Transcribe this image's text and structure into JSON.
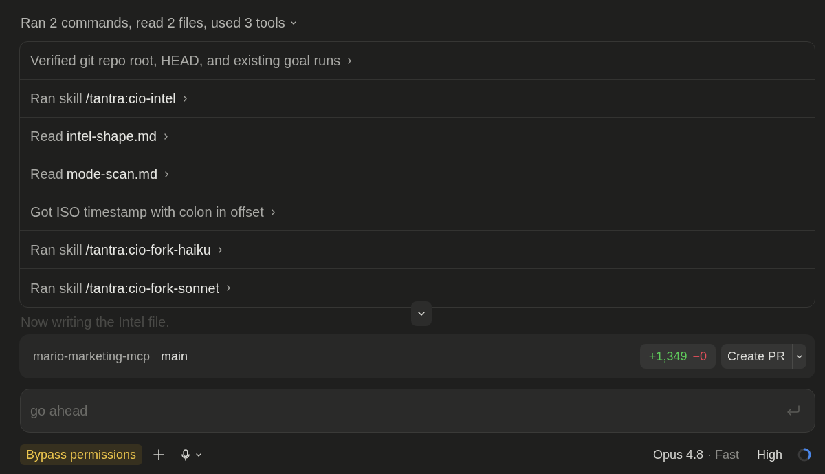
{
  "summary": {
    "text": "Ran 2 commands, read 2 files, used 3 tools",
    "expanded": true
  },
  "steps": [
    {
      "action": "Verified git repo root, HEAD, and existing goal runs",
      "expanded": false
    },
    {
      "action": "Ran skill",
      "target": "/tantra:cio-intel",
      "expanded": false
    },
    {
      "action": "Read",
      "target": "intel-shape.md",
      "expanded": false
    },
    {
      "action": "Read",
      "target": "mode-scan.md",
      "expanded": false
    },
    {
      "action": "Got ISO timestamp with colon in offset",
      "expanded": false
    },
    {
      "action": "Ran skill",
      "target": "/tantra:cio-fork-haiku",
      "expanded": false
    },
    {
      "action": "Ran skill",
      "target": "/tantra:cio-fork-sonnet",
      "expanded": false
    }
  ],
  "status_text": "Now writing the Intel file.",
  "branch_bar": {
    "repo": "mario-marketing-mcp",
    "branch": "main",
    "additions": "+1,349",
    "deletions": "−0",
    "button": "Create PR"
  },
  "composer": {
    "placeholder": "go ahead"
  },
  "footer": {
    "permission_mode": "Bypass permissions",
    "model": "Opus 4.8",
    "speed": "· Fast",
    "effort": "High"
  }
}
